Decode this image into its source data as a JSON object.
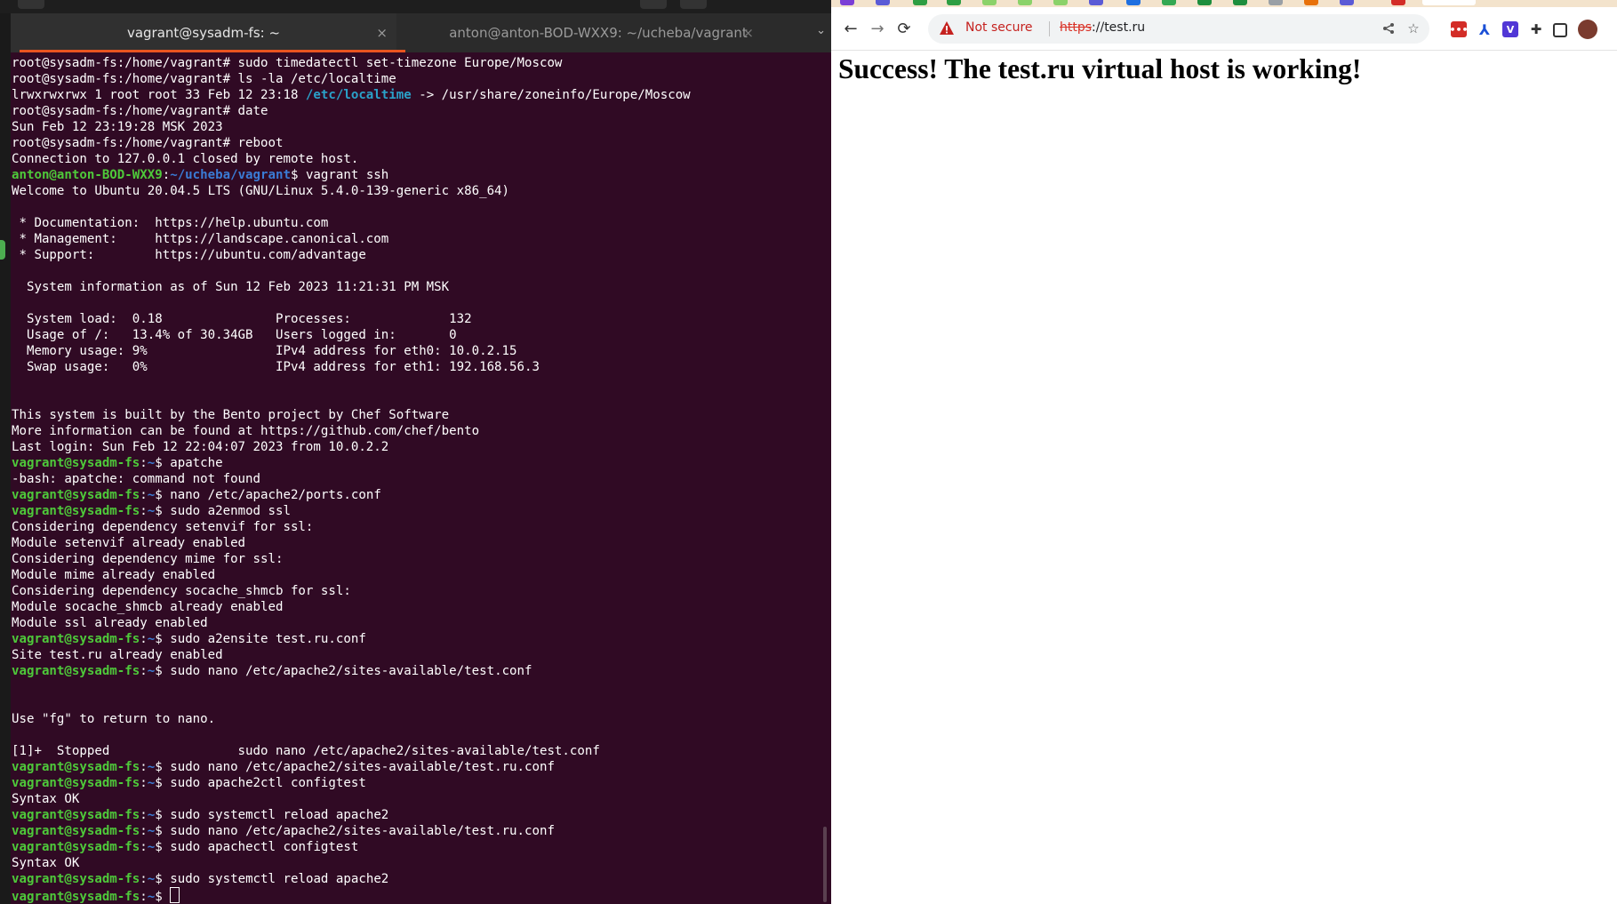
{
  "terminal": {
    "tabs": [
      {
        "title": "vagrant@sysadm-fs: ~"
      },
      {
        "title": "anton@anton-BOD-WXX9: ~/ucheba/vagrant"
      }
    ],
    "close_glyph": "×",
    "menu_glyph": "⌄",
    "lines": [
      [
        "root@sysadm-fs:/home/vagrant# sudo timedatectl set-timezone Europe/Moscow"
      ],
      [
        "root@sysadm-fs:/home/vagrant# ls -la /etc/localtime"
      ],
      [
        "lrwxrwxrwx 1 root root 33 Feb 12 23:18 ",
        "/etc/localtime",
        " -> /usr/share/zoneinfo/Europe/Moscow"
      ],
      [
        "root@sysadm-fs:/home/vagrant# date"
      ],
      [
        "Sun Feb 12 23:19:28 MSK 2023"
      ],
      [
        "root@sysadm-fs:/home/vagrant# reboot"
      ],
      [
        "Connection to 127.0.0.1 closed by remote host."
      ],
      [
        "anton@anton-BOD-WXX9",
        ":",
        "~/ucheba/vagrant",
        "$ vagrant ssh"
      ],
      [
        "Welcome to Ubuntu 20.04.5 LTS (GNU/Linux 5.4.0-139-generic x86_64)"
      ],
      [
        ""
      ],
      [
        " * Documentation:  https://help.ubuntu.com"
      ],
      [
        " * Management:     https://landscape.canonical.com"
      ],
      [
        " * Support:        https://ubuntu.com/advantage"
      ],
      [
        ""
      ],
      [
        "  System information as of Sun 12 Feb 2023 11:21:31 PM MSK"
      ],
      [
        ""
      ],
      [
        "  System load:  0.18               Processes:             132"
      ],
      [
        "  Usage of /:   13.4% of 30.34GB   Users logged in:       0"
      ],
      [
        "  Memory usage: 9%                 IPv4 address for eth0: 10.0.2.15"
      ],
      [
        "  Swap usage:   0%                 IPv4 address for eth1: 192.168.56.3"
      ],
      [
        ""
      ],
      [
        ""
      ],
      [
        "This system is built by the Bento project by Chef Software"
      ],
      [
        "More information can be found at https://github.com/chef/bento"
      ],
      [
        "Last login: Sun Feb 12 22:04:07 2023 from 10.0.2.2"
      ],
      [
        "vagrant@sysadm-fs",
        ":",
        "~",
        "$ apatche"
      ],
      [
        "-bash: apatche: command not found"
      ],
      [
        "vagrant@sysadm-fs",
        ":",
        "~",
        "$ nano /etc/apache2/ports.conf"
      ],
      [
        "vagrant@sysadm-fs",
        ":",
        "~",
        "$ sudo a2enmod ssl"
      ],
      [
        "Considering dependency setenvif for ssl:"
      ],
      [
        "Module setenvif already enabled"
      ],
      [
        "Considering dependency mime for ssl:"
      ],
      [
        "Module mime already enabled"
      ],
      [
        "Considering dependency socache_shmcb for ssl:"
      ],
      [
        "Module socache_shmcb already enabled"
      ],
      [
        "Module ssl already enabled"
      ],
      [
        "vagrant@sysadm-fs",
        ":",
        "~",
        "$ sudo a2ensite test.ru.conf"
      ],
      [
        "Site test.ru already enabled"
      ],
      [
        "vagrant@sysadm-fs",
        ":",
        "~",
        "$ sudo nano /etc/apache2/sites-available/test.conf"
      ],
      [
        ""
      ],
      [
        ""
      ],
      [
        "Use \"fg\" to return to nano."
      ],
      [
        ""
      ],
      [
        "[1]+  Stopped                 sudo nano /etc/apache2/sites-available/test.conf"
      ],
      [
        "vagrant@sysadm-fs",
        ":",
        "~",
        "$ sudo nano /etc/apache2/sites-available/test.ru.conf"
      ],
      [
        "vagrant@sysadm-fs",
        ":",
        "~",
        "$ sudo apache2ctl configtest"
      ],
      [
        "Syntax OK"
      ],
      [
        "vagrant@sysadm-fs",
        ":",
        "~",
        "$ sudo systemctl reload apache2"
      ],
      [
        "vagrant@sysadm-fs",
        ":",
        "~",
        "$ sudo nano /etc/apache2/sites-available/test.ru.conf"
      ],
      [
        "vagrant@sysadm-fs",
        ":",
        "~",
        "$ sudo apachectl configtest"
      ],
      [
        "Syntax OK"
      ],
      [
        "vagrant@sysadm-fs",
        ":",
        "~",
        "$ sudo systemctl reload apache2"
      ],
      [
        "vagrant@sysadm-fs",
        ":",
        "~",
        "$ "
      ]
    ],
    "colors": {
      "background": "#300a24",
      "prompt_user": "#4ec93a",
      "prompt_path": "#3a7bd5",
      "accent": "#e95420"
    }
  },
  "browser": {
    "nav": {
      "back": "←",
      "forward": "→",
      "reload": "⟳"
    },
    "omnibox": {
      "security_label": "Not secure",
      "url_scheme": "https",
      "url_rest": "://test.ru",
      "share_icon": "share-icon",
      "bookmark_icon": "star-icon"
    },
    "extensions": [
      {
        "name": "lastpass-icon",
        "color": "#d32d27",
        "glyph": "•••"
      },
      {
        "name": "translate-icon",
        "color": "#1a4fd6",
        "glyph": "⅄"
      },
      {
        "name": "bitwarden-icon",
        "color": "#5137d6",
        "glyph": "V"
      },
      {
        "name": "puzzle-icon",
        "color": "#333333",
        "glyph": "✚"
      },
      {
        "name": "sidebar-icon",
        "color": "#333333",
        "glyph": "▮"
      },
      {
        "name": "profile-avatar",
        "color": "#7a3b2e",
        "glyph": ""
      }
    ],
    "page": {
      "heading": "Success! The test.ru virtual host is working!"
    }
  }
}
